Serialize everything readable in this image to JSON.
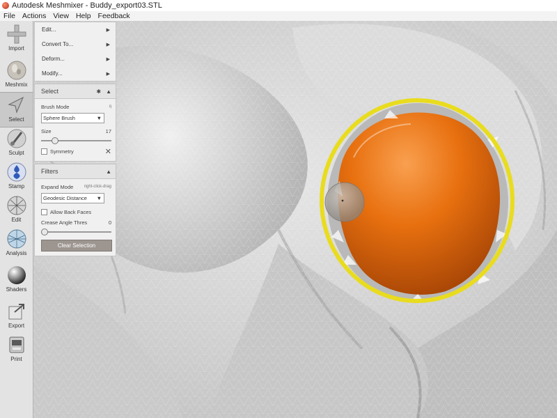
{
  "window": {
    "title": "Autodesk Meshmixer - Buddy_export03.STL"
  },
  "menubar": [
    "File",
    "Actions",
    "View",
    "Help",
    "Feedback"
  ],
  "toolbar": {
    "tools": [
      {
        "label": "Import",
        "icon": "plus-icon"
      },
      {
        "label": "Meshmix",
        "icon": "bunny-head-icon"
      },
      {
        "label": "Select",
        "icon": "arrow-cursor-icon",
        "active": true
      },
      {
        "label": "Sculpt",
        "icon": "brush-icon"
      },
      {
        "label": "Stamp",
        "icon": "stamp-icon"
      },
      {
        "label": "Edit",
        "icon": "sphere-mesh-icon"
      },
      {
        "label": "Analysis",
        "icon": "analysis-sphere-icon"
      },
      {
        "label": "Shaders",
        "icon": "shader-ball-icon"
      },
      {
        "label": "Export",
        "icon": "export-arrow-icon"
      },
      {
        "label": "Print",
        "icon": "printer-icon"
      }
    ]
  },
  "edit_menu": {
    "items": [
      "Edit...",
      "Convert To...",
      "Deform...",
      "Modify..."
    ]
  },
  "select_panel": {
    "title": "Select",
    "brush_mode_label": "Brush Mode",
    "brush_mode_hint": "q",
    "brush_mode_value": "Sphere Brush",
    "size_label": "Size",
    "size_value": "17",
    "size_fraction": 0.19,
    "symmetry_label": "Symmetry",
    "symmetry_checked": false
  },
  "filters_panel": {
    "title": "Filters",
    "expand_mode_label": "Expand Mode",
    "expand_mode_hint": "right-click-drag",
    "expand_mode_value": "Geodesic Distance",
    "allow_back_faces_label": "Allow Back Faces",
    "allow_back_faces_checked": false,
    "crease_angle_label": "Crease Angle Thres",
    "crease_angle_value": "0",
    "crease_angle_fraction": 0.0,
    "clear_selection_label": "Clear Selection"
  },
  "colors": {
    "selection_orange": "#e8700f",
    "highlight_ring": "#f0e030",
    "mesh_gray": "#d4d4d4"
  }
}
